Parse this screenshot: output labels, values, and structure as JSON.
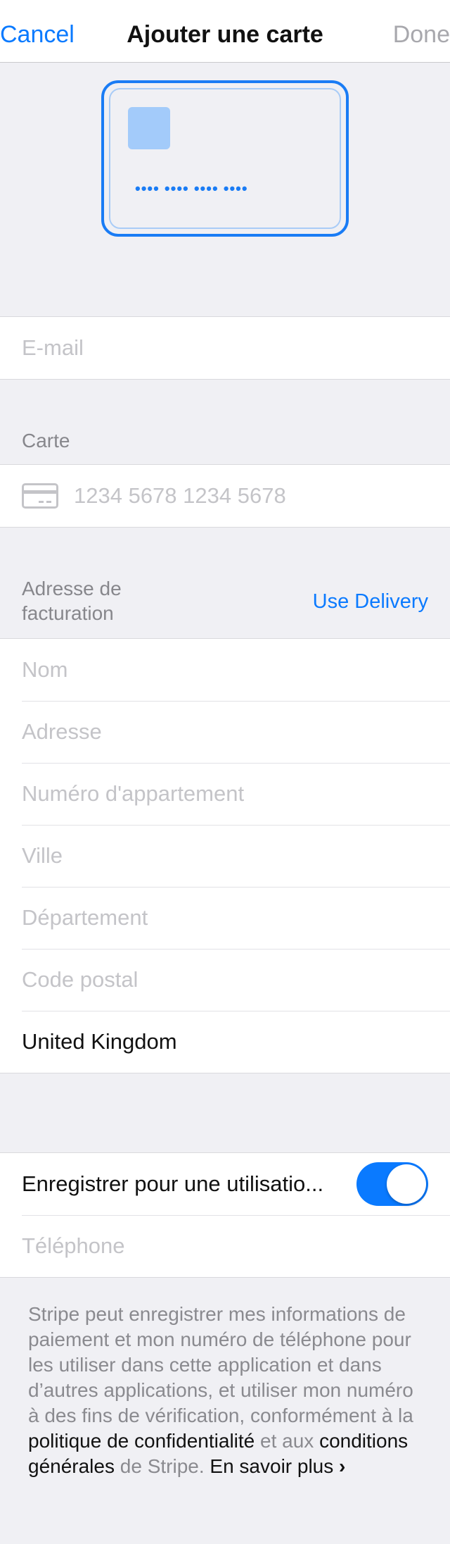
{
  "navbar": {
    "cancel_label": "Cancel",
    "title": "Ajouter une carte",
    "done_label": "Done"
  },
  "card_illustration": {
    "number_mask": "•••• •••• •••• ••••"
  },
  "email": {
    "placeholder": "E-mail"
  },
  "card_section": {
    "header": "Carte",
    "number_placeholder": "1234 5678 1234 5678"
  },
  "billing": {
    "header_line1": "Adresse de",
    "header_line2": "facturation",
    "use_delivery_label": "Use Delivery",
    "fields": {
      "name_placeholder": "Nom",
      "address_placeholder": "Adresse",
      "apartment_placeholder": "Numéro d'appartement",
      "city_placeholder": "Ville",
      "department_placeholder": "Département",
      "postal_placeholder": "Code postal",
      "country_value": "United Kingdom"
    }
  },
  "save": {
    "label": "Enregistrer pour une utilisatio...",
    "toggle_on": true,
    "phone_placeholder": "Téléphone"
  },
  "footer": {
    "text_part1": "Stripe peut enregistrer mes informations de paiement et mon numéro de téléphone pour les utiliser dans cette application et dans d’autres applications, et utiliser mon numéro à des fins de vérification, conformément à la ",
    "privacy_link": "politique de confidentialité",
    "text_part2": " et aux ",
    "terms_link": "conditions générales",
    "text_part3": " de Stripe. ",
    "learn_more_link": "En savoir plus",
    "learn_more_chevron": "›"
  },
  "colors": {
    "accent": "#0a7aff",
    "background": "#f0f0f4",
    "placeholder": "#c4c4c8",
    "section_label": "#87878c"
  }
}
